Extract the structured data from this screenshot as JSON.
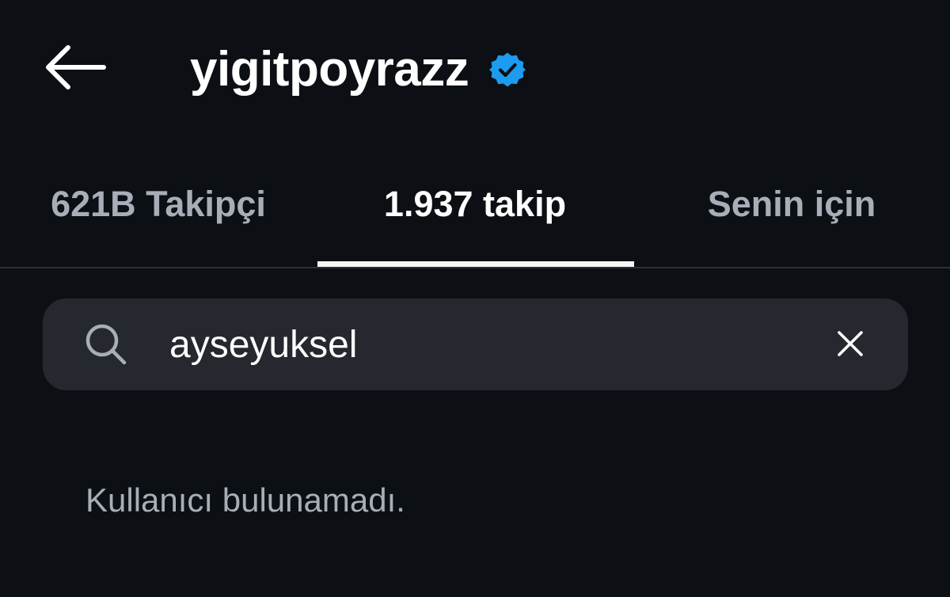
{
  "header": {
    "username": "yigitpoyrazz",
    "verified": true,
    "back_icon": "arrow-left-icon",
    "verified_icon": "verified-badge-icon",
    "verified_color": "#1d9bf0"
  },
  "tabs": [
    {
      "label": "621B Takipçi",
      "active": false
    },
    {
      "label": "1.937 takip",
      "active": true
    },
    {
      "label": "Senin için",
      "active": false
    }
  ],
  "search": {
    "icon": "search-icon",
    "value": "ayseyuksel",
    "placeholder": "",
    "clear_icon": "close-icon"
  },
  "results": {
    "empty_message": "Kullanıcı bulunamadı."
  },
  "colors": {
    "background": "#0c0f14",
    "search_bg": "#25282e",
    "muted_text": "#a8aeb8",
    "accent": "#1d9bf0"
  }
}
